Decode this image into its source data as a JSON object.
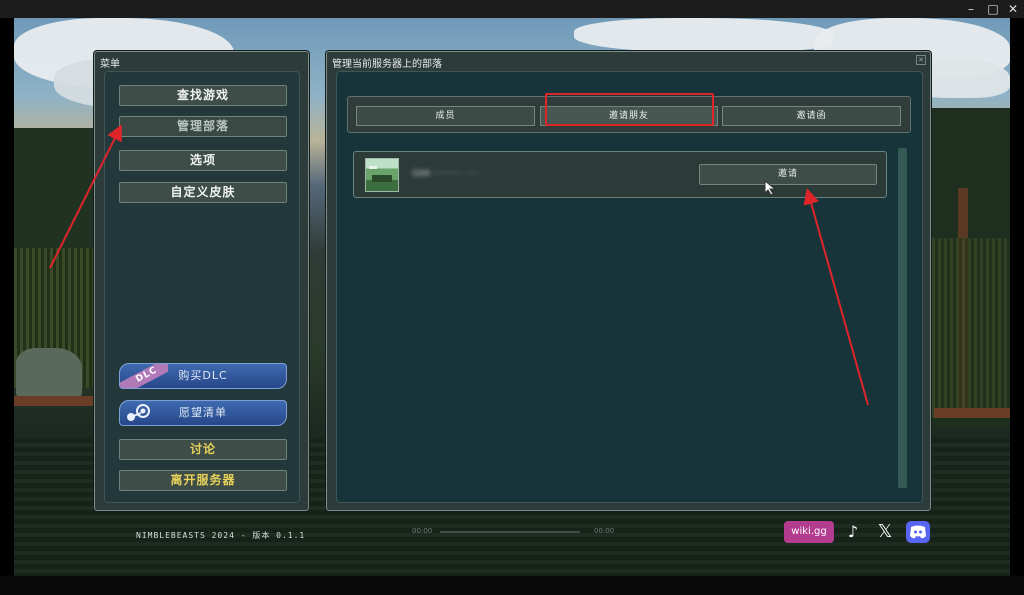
{
  "window": {
    "min_icon": "minimize-icon",
    "max_icon": "maximize-icon",
    "close_icon": "close-icon"
  },
  "menu": {
    "title": "菜单",
    "items": [
      {
        "label": "查找游戏"
      },
      {
        "label": "管理部落"
      },
      {
        "label": "选项"
      },
      {
        "label": "自定义皮肤"
      }
    ],
    "buy_dlc": "购买DLC",
    "dlc_badge": "DLC",
    "wishlist": "愿望清单",
    "discuss": "讨论",
    "leave_server": "离开服务器"
  },
  "tribe_panel": {
    "title": "管理当前服务器上的部落",
    "tabs": [
      {
        "label": "成员"
      },
      {
        "label": "邀请朋友"
      },
      {
        "label": "邀请函"
      }
    ],
    "active_tab": "邀请朋友",
    "friends": [
      {
        "name": "GIIA ·········· ·····",
        "invite_label": "邀请"
      }
    ]
  },
  "footer": {
    "version": "NIMBLEBEASTS 2024 - 版本 0.1.1",
    "wiki": "wiki.gg",
    "player_time_left": "00:00",
    "player_time_right": "00:00"
  },
  "colors": {
    "highlight": "#e0252a",
    "gold_text": "#e8d35a",
    "panel": "#2d3b3a",
    "dlc_blue": "#2f56a0"
  }
}
